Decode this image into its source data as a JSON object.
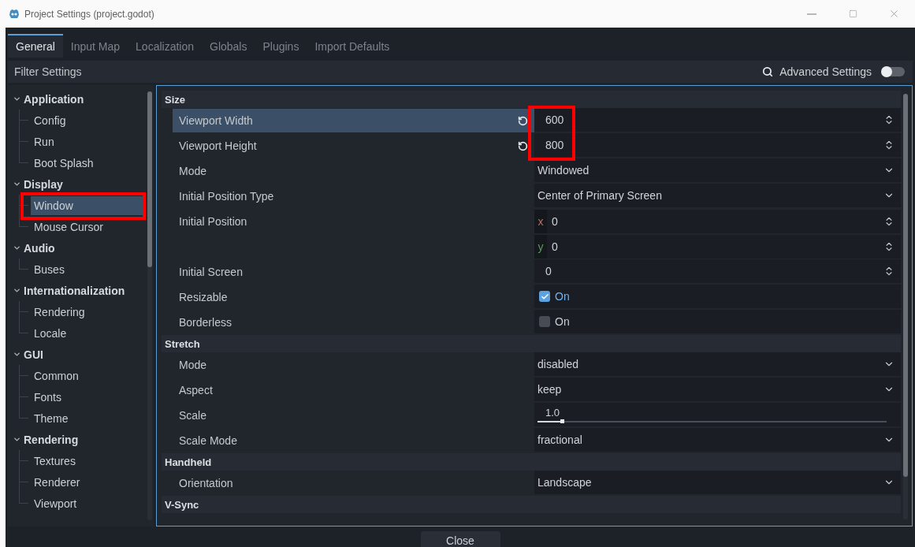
{
  "window": {
    "title": "Project Settings (project.godot)"
  },
  "tabs": [
    {
      "label": "General",
      "selected": true
    },
    {
      "label": "Input Map",
      "selected": false
    },
    {
      "label": "Localization",
      "selected": false
    },
    {
      "label": "Globals",
      "selected": false
    },
    {
      "label": "Plugins",
      "selected": false
    },
    {
      "label": "Import Defaults",
      "selected": false
    }
  ],
  "filter": {
    "placeholder": "Filter Settings"
  },
  "advanced_settings": {
    "label": "Advanced Settings",
    "on": false
  },
  "sidebar": {
    "groups": [
      {
        "label": "Application",
        "expanded": true,
        "children": [
          {
            "label": "Config",
            "selected": false,
            "marked": false
          },
          {
            "label": "Run",
            "selected": false,
            "marked": false
          },
          {
            "label": "Boot Splash",
            "selected": false,
            "marked": false
          }
        ]
      },
      {
        "label": "Display",
        "expanded": true,
        "children": [
          {
            "label": "Window",
            "selected": true,
            "marked": true
          },
          {
            "label": "Mouse Cursor",
            "selected": false,
            "marked": false
          }
        ]
      },
      {
        "label": "Audio",
        "expanded": true,
        "children": [
          {
            "label": "Buses",
            "selected": false,
            "marked": false
          }
        ]
      },
      {
        "label": "Internationalization",
        "expanded": true,
        "children": [
          {
            "label": "Rendering",
            "selected": false,
            "marked": false
          },
          {
            "label": "Locale",
            "selected": false,
            "marked": false
          }
        ]
      },
      {
        "label": "GUI",
        "expanded": true,
        "children": [
          {
            "label": "Common",
            "selected": false,
            "marked": false
          },
          {
            "label": "Fonts",
            "selected": false,
            "marked": false
          },
          {
            "label": "Theme",
            "selected": false,
            "marked": false
          }
        ]
      },
      {
        "label": "Rendering",
        "expanded": true,
        "children": [
          {
            "label": "Textures",
            "selected": false,
            "marked": false
          },
          {
            "label": "Renderer",
            "selected": false,
            "marked": false
          },
          {
            "label": "Viewport",
            "selected": false,
            "marked": false
          }
        ]
      }
    ]
  },
  "inspector": {
    "sections": [
      {
        "title": "Size",
        "rows": [
          {
            "kind": "spin",
            "label": "Viewport Width",
            "value": "600",
            "selected": true,
            "revertable": true,
            "marked": true
          },
          {
            "kind": "spin",
            "label": "Viewport Height",
            "value": "800",
            "selected": false,
            "revertable": true,
            "marked": true
          },
          {
            "kind": "dropdown",
            "label": "Mode",
            "value": "Windowed",
            "selected": false,
            "revertable": false,
            "marked": false
          },
          {
            "kind": "dropdown",
            "label": "Initial Position Type",
            "value": "Center of Primary Screen",
            "selected": false,
            "revertable": false,
            "marked": false
          },
          {
            "kind": "vector",
            "label": "Initial Position",
            "selected": false,
            "revertable": false,
            "marked": false,
            "components": [
              {
                "axis": "x",
                "value": "0",
                "color": "#b0735f"
              },
              {
                "axis": "y",
                "value": "0",
                "color": "#5e9a5e"
              }
            ]
          },
          {
            "kind": "spin",
            "label": "Initial Screen",
            "value": "0",
            "selected": false,
            "revertable": false,
            "marked": false
          },
          {
            "kind": "checkbox",
            "label": "Resizable",
            "value": "On",
            "checked": true,
            "selected": false,
            "revertable": false,
            "marked": false
          },
          {
            "kind": "checkbox",
            "label": "Borderless",
            "value": "On",
            "checked": false,
            "selected": false,
            "revertable": false,
            "marked": false
          }
        ]
      },
      {
        "title": "Stretch",
        "rows": [
          {
            "kind": "dropdown",
            "label": "Mode",
            "value": "disabled",
            "selected": false,
            "revertable": false,
            "marked": false
          },
          {
            "kind": "dropdown",
            "label": "Aspect",
            "value": "keep",
            "selected": false,
            "revertable": false,
            "marked": false
          },
          {
            "kind": "slider",
            "label": "Scale",
            "value": "1.0",
            "level": 0.07,
            "selected": false,
            "revertable": false,
            "marked": false
          },
          {
            "kind": "dropdown",
            "label": "Scale Mode",
            "value": "fractional",
            "selected": false,
            "revertable": false,
            "marked": false
          }
        ]
      },
      {
        "title": "Handheld",
        "rows": [
          {
            "kind": "dropdown",
            "label": "Orientation",
            "value": "Landscape",
            "selected": false,
            "revertable": false,
            "marked": false
          }
        ]
      },
      {
        "title": "V-Sync"
      }
    ]
  },
  "close_button": "Close"
}
